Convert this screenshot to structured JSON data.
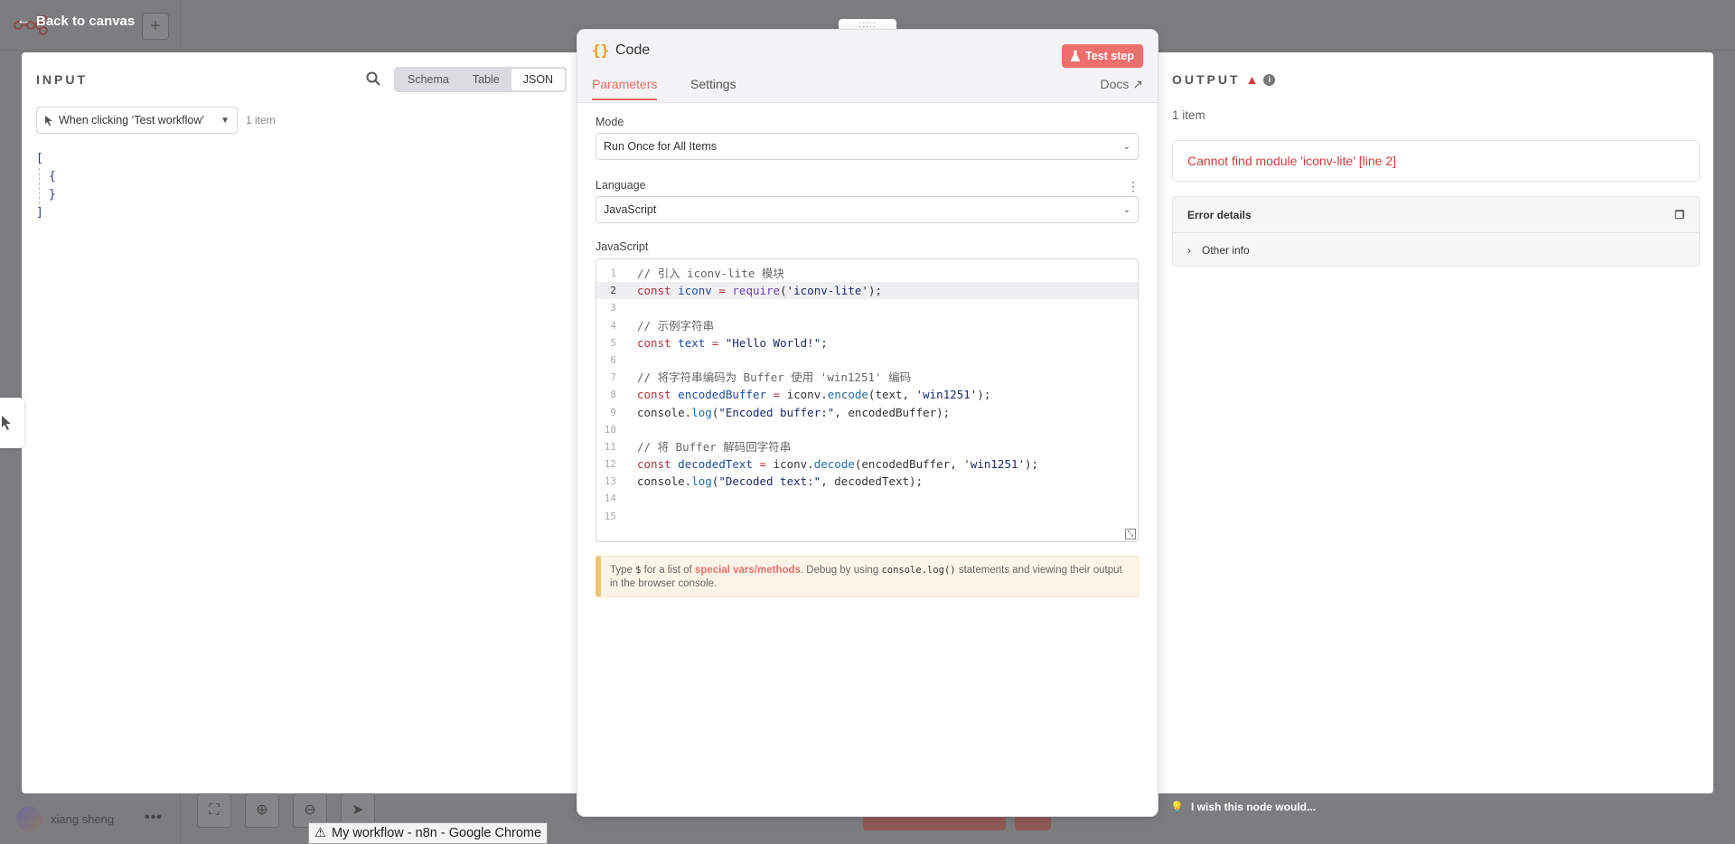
{
  "app": {
    "back_label": "Back to canvas",
    "bg_title": "n8n",
    "user_name": "xiang sheng",
    "chrome_tooltip": "My workflow - n8n - Google Chrome",
    "feedback_label": "I wish this node would...",
    "accent": "#ef6f6c"
  },
  "input": {
    "title": "INPUT",
    "views": [
      "Schema",
      "Table",
      "JSON"
    ],
    "active_view": "JSON",
    "node_selector": "When clicking ‘Test workflow’",
    "item_count": "1 item",
    "json_lines": [
      "[",
      "{",
      "}",
      "]"
    ]
  },
  "node": {
    "icon": "{}",
    "title": "Code",
    "test_step_label": "Test step",
    "tabs": [
      "Parameters",
      "Settings"
    ],
    "docs_label": "Docs",
    "mode_label": "Mode",
    "mode_value": "Run Once for All Items",
    "language_label": "Language",
    "language_value": "JavaScript",
    "code_label": "JavaScript",
    "code_lines": [
      "// 引入 iconv-lite 模块",
      "const iconv = require('iconv-lite');",
      "",
      "// 示例字符串",
      "const text = \"Hello World!\";",
      "",
      "// 将字符串编码为 Buffer 使用 'win1251' 编码",
      "const encodedBuffer = iconv.encode(text, 'win1251');",
      "console.log(\"Encoded buffer:\", encodedBuffer);",
      "",
      "// 将 Buffer 解码回字符串",
      "const decodedText = iconv.decode(encodedBuffer, 'win1251');",
      "console.log(\"Decoded text:\", decodedText);",
      "",
      ""
    ],
    "active_line": 2,
    "hint": {
      "type_text": "Type",
      "dollar": "$",
      "for_text": "for a list of",
      "link_text": "special vars/methods",
      "debug_text": ". Debug by using",
      "code_text": "console.log()",
      "rest_text": "statements and viewing their output in the browser console."
    }
  },
  "output": {
    "title": "OUTPUT",
    "item_count": "1 item",
    "error_message": "Cannot find module 'iconv-lite' [line 2]",
    "details_title": "Error details",
    "other_info_label": "Other info"
  }
}
